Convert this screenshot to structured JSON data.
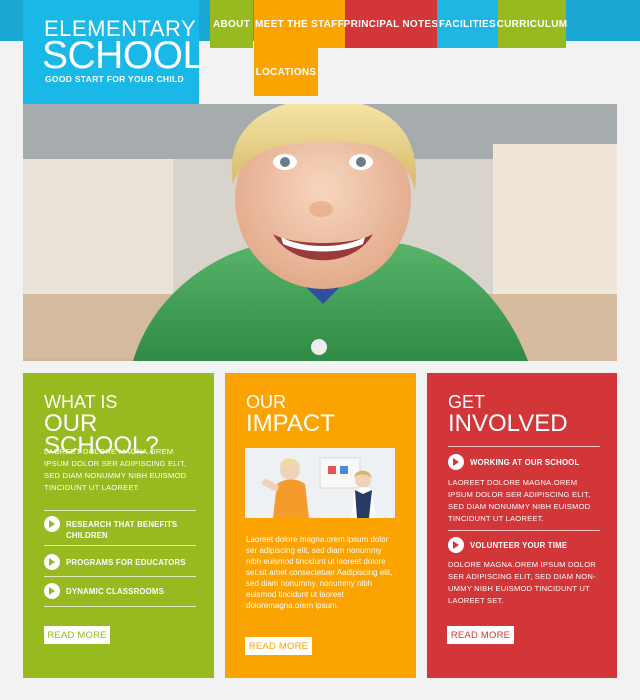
{
  "brand": {
    "line1": "ELEMENTARY",
    "line2": "SCHOOL",
    "tagline": "GOOD START FOR YOUR CHILD",
    "colors": {
      "blue": "#19b8e6",
      "green": "#97ba21",
      "orange": "#fba300",
      "red": "#d33639"
    }
  },
  "nav": {
    "about": "ABOUT",
    "staff": "MEET THE STAFF",
    "notes": "PRINCIPAL NOTES",
    "facilities": "FACILITIES",
    "curriculum": "CURRICULUM",
    "locations": "LOCATIONS"
  },
  "card1": {
    "title_small": "WHAT IS",
    "title_big": "OUR SCHOOL?",
    "text": "LAOREET DOLORE MAGNA.OREM IPSUM DOLOR SER ADIPISCING ELIT, SED DIAM NONUMMY NIBH EUISMOD TINCIDUNT UT LAOREET.",
    "items": [
      "RESEARCH THAT BENEFITS CHILDREN",
      "PROGRAMS FOR EDUCATORS",
      "DYNAMIC CLASSROOMS"
    ],
    "read_more": "READ MORE"
  },
  "card2": {
    "title_small": "OUR",
    "title_big": "IMPACT",
    "text": "Laoreet dolore magna.orem ipsum dolor ser adipiscing elit, sed diam nonummy nibh euismod tincidunt ut laoreet dolore set.sit amet consectetuer Aadipiscing elit, sed diam nonummy. nonummy nibh euismod tincidunt ut laoreet doloremagna.orem ipsum.",
    "read_more": "READ MORE"
  },
  "card3": {
    "title_small": "GET",
    "title_big": "INVOLVED",
    "item1": "WORKING AT OUR SCHOOL",
    "text1": "LAOREET DOLORE MAGNA.OREM IPSUM DOLOR SER ADIPISCING ELIT, SED DIAM NONUMMY NIBH EUISMOD TINCIDUNT UT LAOREET.",
    "item2": "VOLUNTEER YOUR TIME",
    "text2": "DOLORE MAGNA.OREM IPSUM DOLOR SER ADIPISCING ELIT, SED DIAM NON-UMMY NIBH EUISMOD TINCIDUNT UT LAOREET SET.",
    "read_more": "READ MORE"
  }
}
